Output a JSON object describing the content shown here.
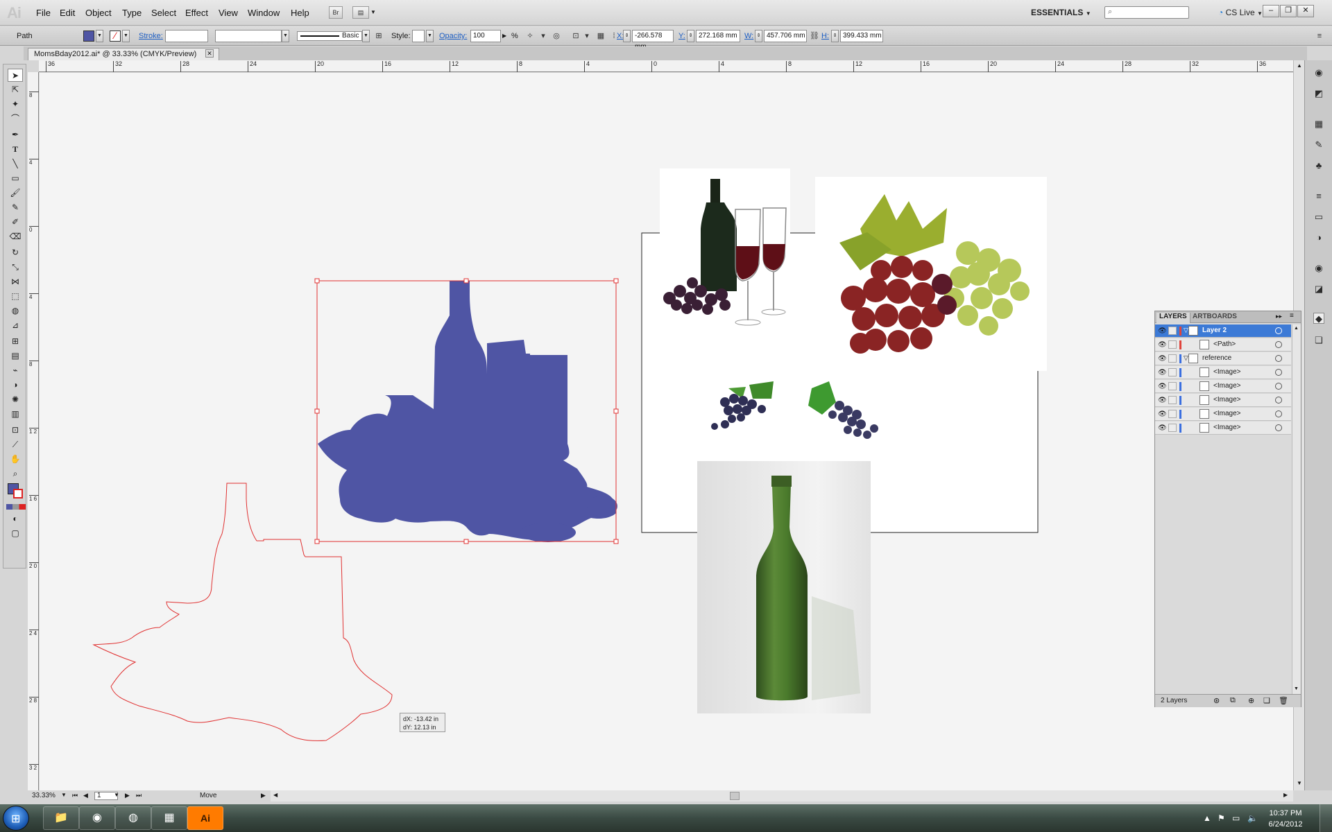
{
  "app": {
    "logo": "Ai"
  },
  "menu": [
    "File",
    "Edit",
    "Object",
    "Type",
    "Select",
    "Effect",
    "View",
    "Window",
    "Help"
  ],
  "bridge_btn": "Br",
  "arrange_btn": "▤",
  "workspace": "ESSENTIALS",
  "cslive": "CS Live",
  "window_controls": {
    "minimize": "–",
    "restore": "❐",
    "close": "✕"
  },
  "control": {
    "selection_type": "Path",
    "stroke_label": "Stroke:",
    "brush_label": "Basic",
    "style_label": "Style:",
    "opacity_label": "Opacity:",
    "opacity_value": "100",
    "percent": "%",
    "x_label": "X:",
    "x_value": "-266.578 mm",
    "y_label": "Y:",
    "y_value": "272.168 mm",
    "w_label": "W:",
    "w_value": "457.706 mm",
    "h_label": "H:",
    "h_value": "399.433 mm"
  },
  "document": {
    "tab_title": "MomsBday2012.ai* @ 33.33% (CMYK/Preview)",
    "close": "✕"
  },
  "ruler": {
    "h_ticks": [
      "36",
      "32",
      "28",
      "24",
      "20",
      "16",
      "12",
      "8",
      "4",
      "0",
      "4",
      "8",
      "12",
      "16",
      "20",
      "24",
      "28",
      "32",
      "36"
    ],
    "v_ticks": [
      "8",
      "4",
      "0",
      "4",
      "8",
      "1 2",
      "1 6",
      "2 0",
      "2 4",
      "2 8",
      "3 2"
    ]
  },
  "status": {
    "zoom": "33.33%",
    "artboard": "1",
    "tool": "Move"
  },
  "tooltip": {
    "dx": "dX: -13.42 in",
    "dy": "dY: 12.13 in"
  },
  "layers_panel": {
    "tabs": [
      "LAYERS",
      "ARTBOARDS"
    ],
    "rows": [
      {
        "name": "Layer 2",
        "indent": 0,
        "color": "#e0443c",
        "selected": true,
        "expanded": true
      },
      {
        "name": "<Path>",
        "indent": 1,
        "color": "#e0443c",
        "selected": false
      },
      {
        "name": "reference",
        "indent": 0,
        "color": "#3b6fe0",
        "selected": false,
        "expanded": true
      },
      {
        "name": "<Image>",
        "indent": 1,
        "color": "#3b6fe0",
        "selected": false
      },
      {
        "name": "<Image>",
        "indent": 1,
        "color": "#3b6fe0",
        "selected": false
      },
      {
        "name": "<Image>",
        "indent": 1,
        "color": "#3b6fe0",
        "selected": false
      },
      {
        "name": "<Image>",
        "indent": 1,
        "color": "#3b6fe0",
        "selected": false
      },
      {
        "name": "<Image>",
        "indent": 1,
        "color": "#3b6fe0",
        "selected": false
      }
    ],
    "footer_count": "2 Layers"
  },
  "colors": {
    "silhouette": "#4f55a4",
    "outline": "#e03030",
    "selection": "#e03030",
    "wine": "#5e0f17",
    "bottle_green": "#3f6b2a"
  },
  "taskbar": {
    "time": "10:37 PM",
    "date": "6/24/2012",
    "apps": [
      {
        "name": "explorer",
        "glyph": "📁"
      },
      {
        "name": "chrome",
        "glyph": "◉"
      },
      {
        "name": "firefox",
        "glyph": "◍"
      },
      {
        "name": "calculator",
        "glyph": "▦"
      },
      {
        "name": "illustrator",
        "glyph": "Ai"
      }
    ]
  }
}
